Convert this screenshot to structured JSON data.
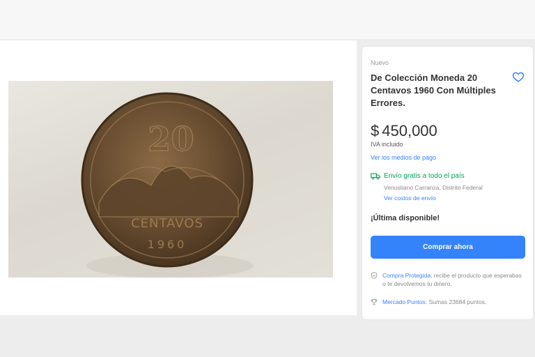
{
  "listing": {
    "condition": "Nuevo",
    "title": "De Colección Moneda 20 Centavos 1960 Con Múltiples Errores.",
    "price_currency": "$",
    "price_amount": "450,000",
    "tax_note": "IVA incluido",
    "payment_link": "Ver los medios de pago",
    "stock": "¡Última disponible!",
    "buy_button": "Comprar ahora"
  },
  "shipping": {
    "free_label": "Envío gratis a todo el país",
    "location": "Venustiano Carranza, Distrito Federal",
    "costs_link": "Ver costos de envío",
    "icon": "truck-icon"
  },
  "protection": {
    "link": "Compra Protegida",
    "text": ", recibe el producto que esperabas o te devolvemos tu dinero.",
    "icon": "shield-icon"
  },
  "points": {
    "link": "Mercado Puntos",
    "text": ". Sumas 23684 puntos.",
    "icon": "trophy-icon"
  },
  "coin": {
    "denomination": "20",
    "label": "CENTAVOS",
    "year": "1960"
  },
  "colors": {
    "accent": "#3483fa",
    "shipping": "#00a650",
    "coin": "#5a4128"
  }
}
